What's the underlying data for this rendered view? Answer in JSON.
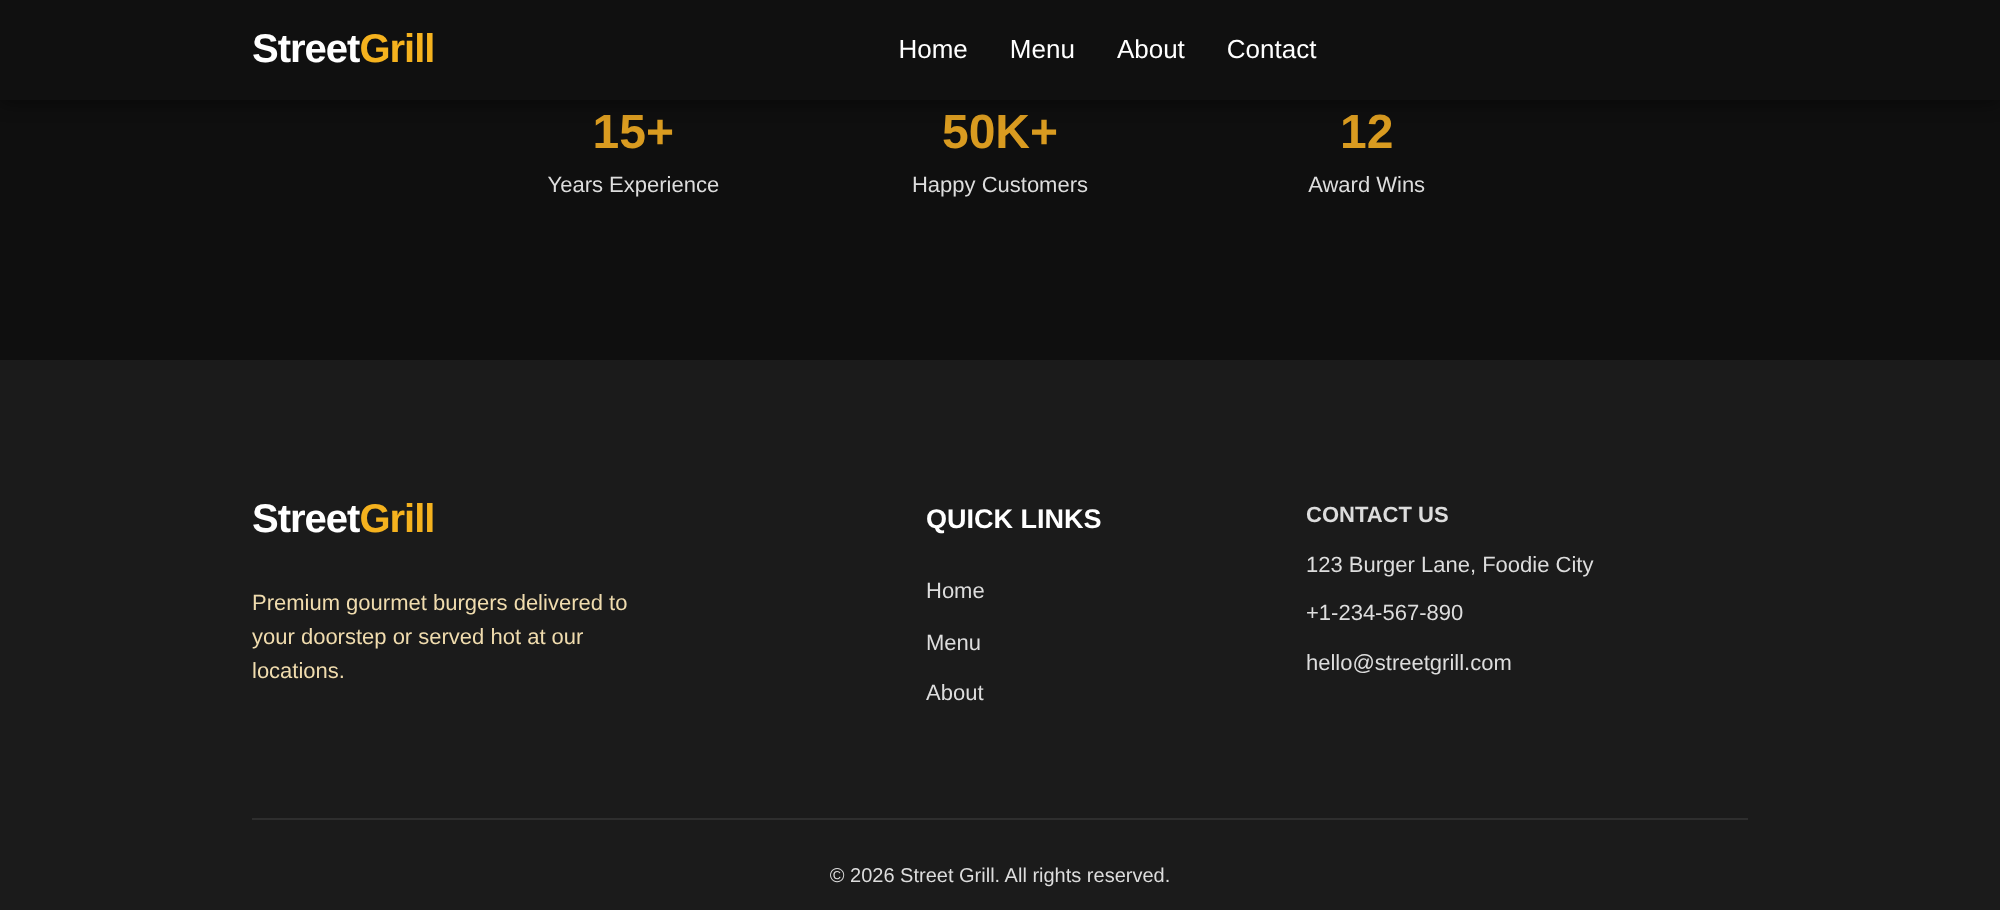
{
  "navbar": {
    "brand": {
      "first": "Street",
      "second": "Grill"
    },
    "links": [
      "Home",
      "Menu",
      "About",
      "Contact"
    ]
  },
  "stats": [
    {
      "value": "15+",
      "label": "Years Experience"
    },
    {
      "value": "50K+",
      "label": "Happy Customers"
    },
    {
      "value": "12",
      "label": "Award Wins"
    }
  ],
  "footer": {
    "brand": {
      "first": "Street",
      "second": "Grill"
    },
    "description": "Premium gourmet burgers delivered to your doorstep or served hot at our locations.",
    "quick_links": {
      "heading": "QUICK LINKS",
      "links": [
        "Home",
        "Menu",
        "About"
      ]
    },
    "contact": {
      "heading": "CONTACT US",
      "lines": [
        "123 Burger Lane, Foodie City",
        "+1-234-567-890",
        "hello@streetgrill.com"
      ]
    },
    "copyright": "© 2026 Street Grill. All rights reserved."
  }
}
